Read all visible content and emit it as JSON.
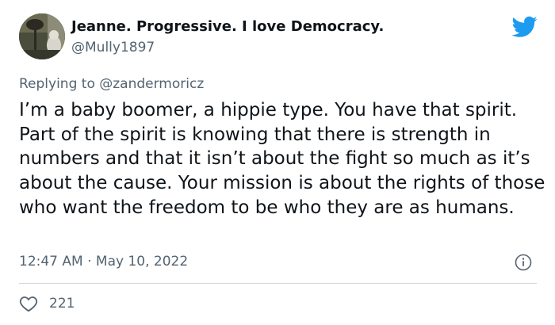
{
  "author": {
    "display_name": "Jeanne. Progressive. I love Democracy.",
    "handle": "@Mully1897"
  },
  "reply": {
    "prefix": "Replying to ",
    "mention": "@zandermoricz"
  },
  "tweet": {
    "text": "I’m a baby boomer, a hippie type. You have that spirit. Part of the spirit is knowing that there is strength in numbers and that it isn’t about the fight so much as it’s about the cause. Your mission is about the rights of those who want the freedom to be who they are as humans.",
    "timestamp": "12:47 AM · May 10, 2022"
  },
  "actions": {
    "like_count": "221"
  },
  "icons": {
    "brand": "twitter-bird-icon",
    "info": "info-icon",
    "like": "heart-icon"
  },
  "colors": {
    "brand_blue": "#1d9bf0",
    "text_primary": "#0f1419",
    "text_secondary": "#536471",
    "divider": "#cfd9de"
  }
}
